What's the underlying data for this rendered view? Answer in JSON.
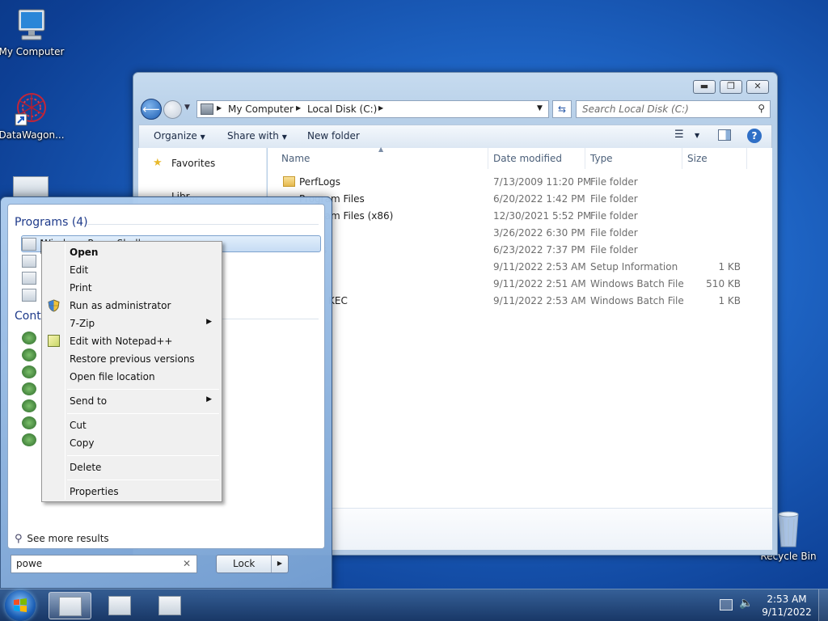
{
  "desktop": {
    "icons": [
      {
        "label": "My Computer"
      },
      {
        "label": "DataWagon..."
      },
      {
        "label": "Recycle Bin"
      }
    ]
  },
  "explorer": {
    "breadcrumb": [
      "My Computer",
      "Local Disk (C:)"
    ],
    "search_placeholder": "Search Local Disk (C:)",
    "toolbar": {
      "organize": "Organize",
      "share_with": "Share with",
      "new_folder": "New folder"
    },
    "nav": {
      "favorites": "Favorites",
      "libraries_partial": "Libr..."
    },
    "columns": [
      "Name",
      "Date modified",
      "Type",
      "Size"
    ],
    "rows": [
      {
        "name": "PerfLogs",
        "date": "7/13/2009 11:20 PM",
        "type": "File folder",
        "size": ""
      },
      {
        "name": "Program Files",
        "date": "6/20/2022 1:42 PM",
        "type": "File folder",
        "size": ""
      },
      {
        "name": "Program Files (x86)",
        "date": "12/30/2021 5:52 PM",
        "type": "File folder",
        "size": ""
      },
      {
        "name": "",
        "date": "3/26/2022 6:30 PM",
        "type": "File folder",
        "size": ""
      },
      {
        "name": "ys",
        "date": "6/23/2022 7:37 PM",
        "type": "File folder",
        "size": ""
      },
      {
        "name": "",
        "date": "9/11/2022 2:53 AM",
        "type": "Setup Information",
        "size": "1 KB"
      },
      {
        "name": "",
        "date": "9/11/2022 2:51 AM",
        "type": "Windows Batch File",
        "size": "510 KB"
      },
      {
        "name": "KEC",
        "date": "9/11/2022 2:53 AM",
        "type": "Windows Batch File",
        "size": "1 KB"
      }
    ]
  },
  "start_menu": {
    "programs_header": "Programs (4)",
    "control_header": "Contr",
    "highlighted_item": "Windows PowerShell",
    "see_more": "See more results",
    "search_value": "powe",
    "lock_label": "Lock"
  },
  "context_menu": {
    "items": [
      {
        "label": "Open",
        "bold": true
      },
      {
        "label": "Edit"
      },
      {
        "label": "Print"
      },
      {
        "label": "Run as administrator",
        "icon": "uac-shield-icon"
      },
      {
        "label": "7-Zip",
        "submenu": true
      },
      {
        "label": "Edit with Notepad++",
        "icon": "notepadpp-icon"
      },
      {
        "label": "Restore previous versions"
      },
      {
        "label": "Open file location"
      },
      {
        "label": "Send to",
        "submenu": true
      },
      {
        "label": "Cut"
      },
      {
        "label": "Copy"
      },
      {
        "label": "Delete"
      },
      {
        "label": "Properties"
      }
    ]
  },
  "taskbar": {
    "time": "2:53 AM",
    "date": "9/11/2022"
  },
  "colors": {
    "accent": "#1e64c4",
    "highlight": "#cce4f7",
    "link": "#1e3a8a"
  }
}
